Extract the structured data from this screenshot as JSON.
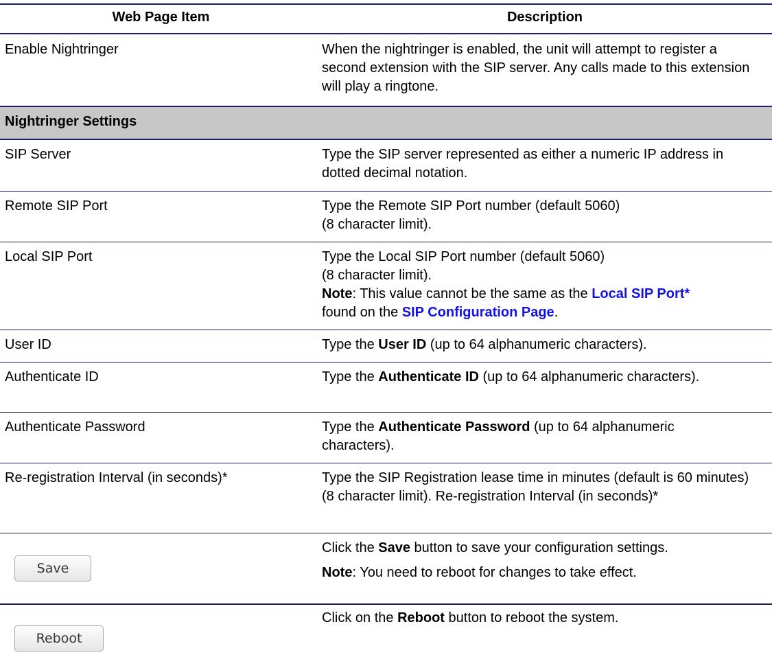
{
  "header": {
    "col1": "Web Page Item",
    "col2": "Description"
  },
  "rows": {
    "enable": {
      "item": "Enable Nightringer",
      "desc": "When the nightringer is enabled, the unit will attempt to register a second extension with the SIP server. Any calls made to this extension will play a ringtone."
    },
    "section": {
      "title": "Nightringer Settings"
    },
    "sip_server": {
      "item": "SIP Server",
      "desc": "Type the SIP server represented as either a numeric IP address in dotted decimal notation."
    },
    "remote_port": {
      "item": "Remote SIP Port",
      "desc_l1": "Type the Remote SIP Port number (default 5060)",
      "desc_l2": "(8 character limit)."
    },
    "local_port": {
      "item": "Local SIP Port",
      "desc_l1": "Type the Local SIP Port number (default 5060)",
      "desc_l2": "(8 character limit).",
      "note_label": "Note",
      "note_text": ": This value cannot be the same as the ",
      "note_link1": "Local SIP Port*",
      "note_text2": "found on the ",
      "note_link2": "SIP Configuration Page",
      "note_end": "."
    },
    "user_id": {
      "item": "User ID",
      "desc_pre": "Type the ",
      "desc_bold": "User ID",
      "desc_post": " (up to 64 alphanumeric characters)."
    },
    "auth_id": {
      "item": "Authenticate ID",
      "desc_pre": "Type the ",
      "desc_bold": "Authenticate ID",
      "desc_post": " (up to 64 alphanumeric characters)."
    },
    "auth_pw": {
      "item": "Authenticate Password",
      "desc_pre": "Type the ",
      "desc_bold": "Authenticate Password",
      "desc_post": " (up to 64 alphanumeric characters)."
    },
    "rereg": {
      "item": "Re-registration Interval (in seconds)*",
      "desc": "Type the SIP Registration lease time in minutes (default is 60 minutes) (8 character limit). Re-registration Interval (in seconds)*"
    },
    "save": {
      "button": "Save",
      "desc_pre": "Click the ",
      "desc_bold": "Save",
      "desc_post": " button to save your configuration settings.",
      "note_label": "Note",
      "note_text": ": You need to reboot for changes to take effect."
    },
    "reboot": {
      "button": "Reboot",
      "desc_pre": "Click on the ",
      "desc_bold": "Reboot",
      "desc_post": " button to reboot the system."
    }
  }
}
